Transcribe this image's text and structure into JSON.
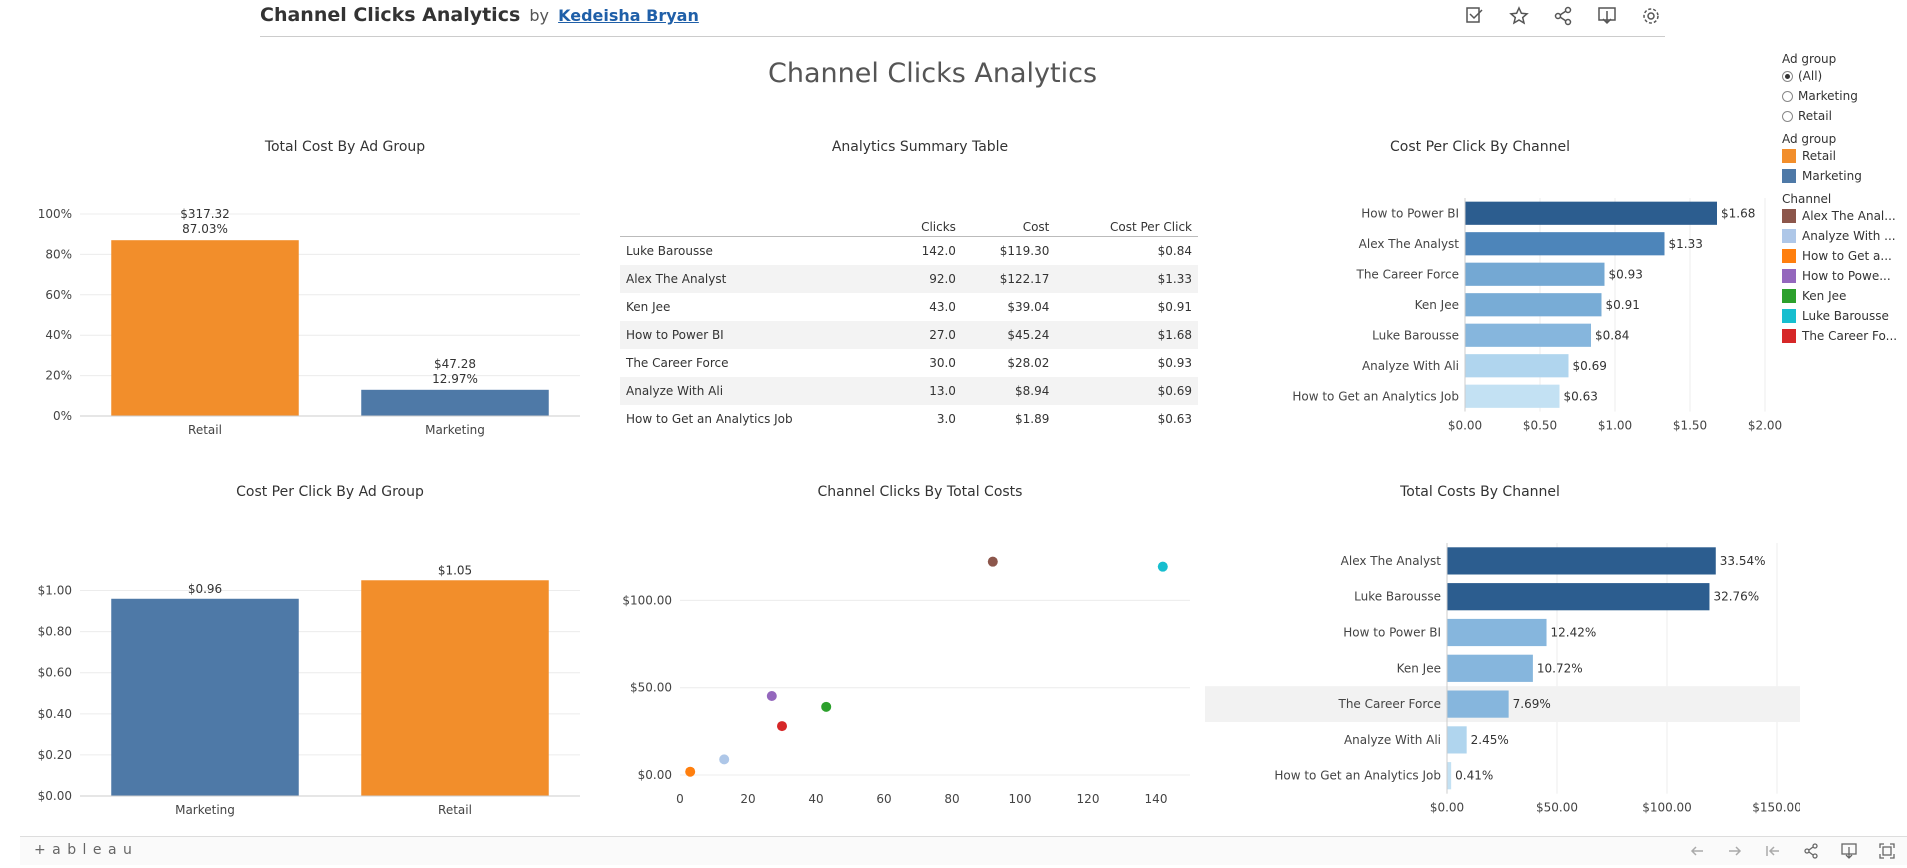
{
  "header": {
    "title": "Channel Clicks Analytics",
    "by": "by",
    "author": "Kedeisha Bryan",
    "icons": [
      "edit-icon",
      "star-icon",
      "share-icon",
      "download-icon",
      "gear-icon"
    ]
  },
  "dashboard_title": "Channel Clicks Analytics",
  "filters": {
    "ad_group_filter": {
      "title": "Ad group",
      "options": [
        "(All)",
        "Marketing",
        "Retail"
      ],
      "selected": "(All)"
    },
    "ad_group_legend": {
      "title": "Ad group",
      "items": [
        {
          "label": "Retail",
          "color": "#f28e2b"
        },
        {
          "label": "Marketing",
          "color": "#4e79a7"
        }
      ]
    },
    "channel_legend": {
      "title": "Channel",
      "items": [
        {
          "label": "Alex The Anal...",
          "color": "#8c564b"
        },
        {
          "label": "Analyze With ...",
          "color": "#aec7e8"
        },
        {
          "label": "How to Get a...",
          "color": "#ff7f0e"
        },
        {
          "label": "How to Powe...",
          "color": "#9467bd"
        },
        {
          "label": "Ken Jee",
          "color": "#2ca02c"
        },
        {
          "label": "Luke Barousse",
          "color": "#17becf"
        },
        {
          "label": "The Career Fo...",
          "color": "#d62728"
        }
      ]
    }
  },
  "summary_table": {
    "title": "Analytics Summary Table",
    "columns": [
      "Clicks",
      "Cost",
      "Cost Per Click"
    ],
    "rows": [
      {
        "name": "Luke Barousse",
        "clicks": "142.0",
        "cost": "$119.30",
        "cpc": "$0.84"
      },
      {
        "name": "Alex The Analyst",
        "clicks": "92.0",
        "cost": "$122.17",
        "cpc": "$1.33"
      },
      {
        "name": "Ken Jee",
        "clicks": "43.0",
        "cost": "$39.04",
        "cpc": "$0.91"
      },
      {
        "name": "How to Power BI",
        "clicks": "27.0",
        "cost": "$45.24",
        "cpc": "$1.68"
      },
      {
        "name": "The Career Force",
        "clicks": "30.0",
        "cost": "$28.02",
        "cpc": "$0.93"
      },
      {
        "name": "Analyze With Ali",
        "clicks": "13.0",
        "cost": "$8.94",
        "cpc": "$0.69"
      },
      {
        "name": "How to Get an Analytics Job",
        "clicks": "3.0",
        "cost": "$1.89",
        "cpc": "$0.63"
      }
    ]
  },
  "chart_data": [
    {
      "id": "total_cost_by_ad_group",
      "type": "bar",
      "title": "Total Cost By Ad Group",
      "categories": [
        "Retail",
        "Marketing"
      ],
      "values": [
        87.03,
        12.97
      ],
      "labels_top": [
        "$317.32",
        "$47.28"
      ],
      "labels_bottom": [
        "87.03%",
        "12.97%"
      ],
      "colors": [
        "#f28e2b",
        "#4e79a7"
      ],
      "yticks": [
        "0%",
        "20%",
        "40%",
        "60%",
        "80%",
        "100%"
      ],
      "ylim": [
        0,
        100
      ]
    },
    {
      "id": "cpc_by_channel",
      "type": "bar",
      "orientation": "horizontal",
      "title": "Cost Per Click By Channel",
      "categories": [
        "How to Power BI",
        "Alex The Analyst",
        "The Career Force",
        "Ken Jee",
        "Luke Barousse",
        "Analyze With Ali",
        "How to Get an Analytics Job"
      ],
      "values": [
        1.68,
        1.33,
        0.93,
        0.91,
        0.84,
        0.69,
        0.63
      ],
      "value_labels": [
        "$1.68",
        "$1.33",
        "$0.93",
        "$0.91",
        "$0.84",
        "$0.69",
        "$0.63"
      ],
      "colors": [
        "#2c5d8f",
        "#4d85ba",
        "#74a8d3",
        "#78acd6",
        "#86b6dd",
        "#b0d5ee",
        "#c3e1f3"
      ],
      "xticks": [
        "$0.00",
        "$0.50",
        "$1.00",
        "$1.50",
        "$2.00"
      ],
      "xlim": [
        0,
        2
      ]
    },
    {
      "id": "cpc_by_ad_group",
      "type": "bar",
      "title": "Cost Per Click By Ad Group",
      "categories": [
        "Marketing",
        "Retail"
      ],
      "values": [
        0.96,
        1.05
      ],
      "value_labels": [
        "$0.96",
        "$1.05"
      ],
      "colors": [
        "#4e79a7",
        "#f28e2b"
      ],
      "yticks": [
        "$0.00",
        "$0.20",
        "$0.40",
        "$0.60",
        "$0.80",
        "$1.00"
      ],
      "ylim": [
        0,
        1.1
      ]
    },
    {
      "id": "clicks_by_total_costs",
      "type": "scatter",
      "title": "Channel Clicks By Total Costs",
      "points": [
        {
          "x": 92,
          "y": 122.17,
          "color": "#8c564b"
        },
        {
          "x": 142,
          "y": 119.3,
          "color": "#17becf"
        },
        {
          "x": 27,
          "y": 45.24,
          "color": "#9467bd"
        },
        {
          "x": 43,
          "y": 39.04,
          "color": "#2ca02c"
        },
        {
          "x": 30,
          "y": 28.02,
          "color": "#d62728"
        },
        {
          "x": 13,
          "y": 8.94,
          "color": "#aec7e8"
        },
        {
          "x": 3,
          "y": 1.89,
          "color": "#ff7f0e"
        }
      ],
      "xticks": [
        "0",
        "20",
        "40",
        "60",
        "80",
        "100",
        "120",
        "140"
      ],
      "yticks": [
        "$0.00",
        "$50.00",
        "$100.00"
      ],
      "xlim": [
        0,
        150
      ],
      "ylim": [
        0,
        130
      ]
    },
    {
      "id": "total_costs_by_channel",
      "type": "bar",
      "orientation": "horizontal",
      "title": "Total Costs By Channel",
      "categories": [
        "Alex The Analyst",
        "Luke Barousse",
        "How to Power BI",
        "Ken Jee",
        "The Career Force",
        "Analyze With Ali",
        "How to Get an Analytics Job"
      ],
      "values": [
        122.17,
        119.3,
        45.24,
        39.04,
        28.02,
        8.94,
        1.89
      ],
      "value_labels": [
        "33.54%",
        "32.76%",
        "12.42%",
        "10.72%",
        "7.69%",
        "2.45%",
        "0.41%"
      ],
      "colors": [
        "#2c5d8f",
        "#2c5d8f",
        "#86b6dd",
        "#86b6dd",
        "#86b6dd",
        "#b0d5ee",
        "#c3e1f3"
      ],
      "highlight_row": "The Career Force",
      "xticks": [
        "$0.00",
        "$50.00",
        "$100.00",
        "$150.00"
      ],
      "xlim": [
        0,
        150
      ]
    }
  ],
  "footer": {
    "logo": "+ a b l e a u",
    "icons": [
      "undo-icon",
      "redo-icon",
      "revert-icon",
      "share-icon",
      "download-icon",
      "fullscreen-icon"
    ]
  }
}
